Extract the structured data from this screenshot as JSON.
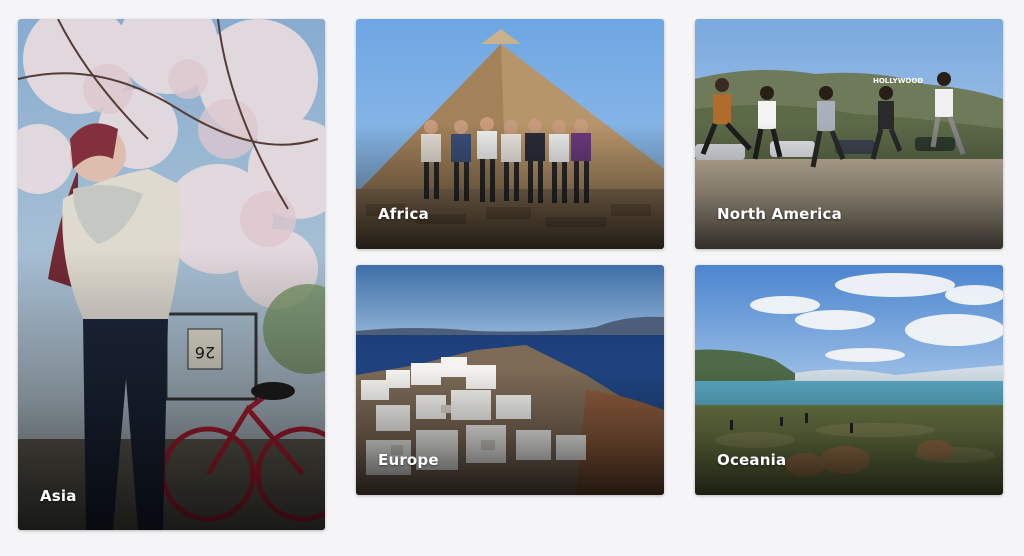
{
  "regions": [
    {
      "id": "asia",
      "label": "Asia",
      "photo": "cherry-blossom-woman-bicycle"
    },
    {
      "id": "africa",
      "label": "Africa",
      "photo": "pyramid-group"
    },
    {
      "id": "north_america",
      "label": "North America",
      "photo": "hollywood-sign-jumping-group"
    },
    {
      "id": "europe",
      "label": "Europe",
      "photo": "santorini-village-sea"
    },
    {
      "id": "oceania",
      "label": "Oceania",
      "photo": "lake-mountains-meadow"
    }
  ],
  "colors": {
    "page_background": "#f5f5f7",
    "label_text": "#ffffff"
  }
}
